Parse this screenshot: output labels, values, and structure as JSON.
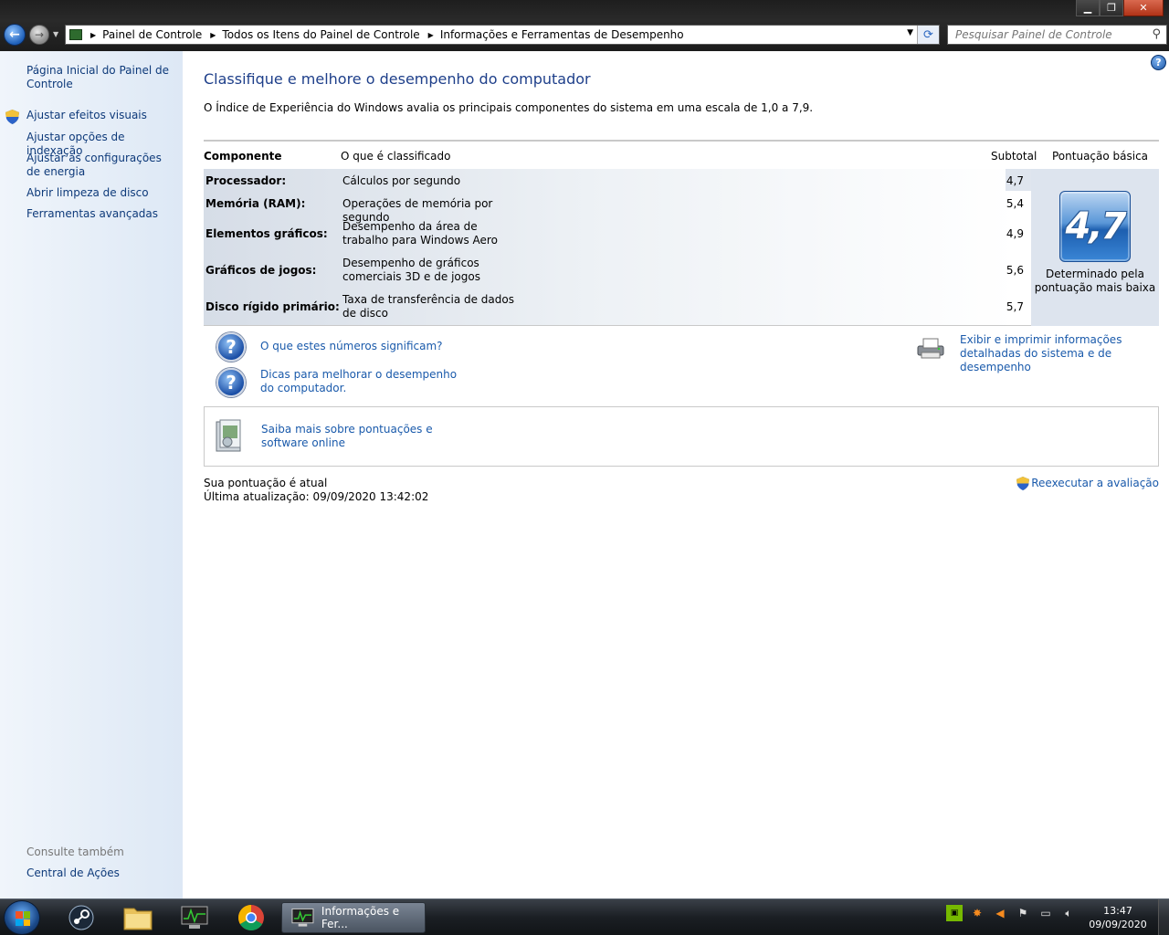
{
  "window": {
    "minimize": "▁",
    "maximize": "❐",
    "close": "✕"
  },
  "address": {
    "crumbs": [
      "Painel de Controle",
      "Todos os Itens do Painel de Controle",
      "Informações e Ferramentas de Desempenho"
    ]
  },
  "search": {
    "placeholder": "Pesquisar Painel de Controle"
  },
  "sidebar": {
    "home": "Página Inicial do Painel de Controle",
    "items": [
      "Ajustar efeitos visuais",
      "Ajustar opções de indexação",
      "Ajustar as configurações de energia",
      "Abrir limpeza de disco",
      "Ferramentas avançadas"
    ],
    "see_also": "Consulte também",
    "see_also_items": [
      "Central de Ações"
    ]
  },
  "main": {
    "title": "Classifique e melhore o desempenho do computador",
    "intro": "O Índice de Experiência do Windows avalia os principais componentes do sistema em uma escala de 1,0 a 7,9.",
    "table": {
      "headers": {
        "component": "Componente",
        "what": "O que é classificado",
        "subtotal": "Subtotal",
        "base": "Pontuação básica"
      },
      "rows": [
        {
          "component": "Processador:",
          "what": "Cálculos por segundo",
          "subtotal": "4,7"
        },
        {
          "component": "Memória (RAM):",
          "what": "Operações de memória por segundo",
          "subtotal": "5,4"
        },
        {
          "component": "Elementos gráficos:",
          "what": "Desempenho da área de trabalho para Windows Aero",
          "subtotal": "4,9"
        },
        {
          "component": "Gráficos de jogos:",
          "what": "Desempenho de gráficos comerciais 3D e de jogos",
          "subtotal": "5,6"
        },
        {
          "component": "Disco rígido primário:",
          "what": "Taxa de transferência de dados de disco",
          "subtotal": "5,7"
        }
      ],
      "base_score": "4,7",
      "base_note": "Determinado pela pontuação mais baixa"
    },
    "links": {
      "meaning": "O que estes números significam?",
      "tips": "Dicas para melhorar o desempenho do computador.",
      "print": "Exibir e imprimir informações detalhadas do sistema e de desempenho",
      "learn": "Saiba mais sobre pontuações e software online"
    },
    "status": {
      "current": "Sua pontuação é atual",
      "updated": "Última atualização: 09/09/2020 13:42:02"
    },
    "rerun": "Reexecutar a avaliação"
  },
  "taskbar": {
    "active_window": "Informações e Fer...",
    "time": "13:47",
    "date": "09/09/2020"
  }
}
